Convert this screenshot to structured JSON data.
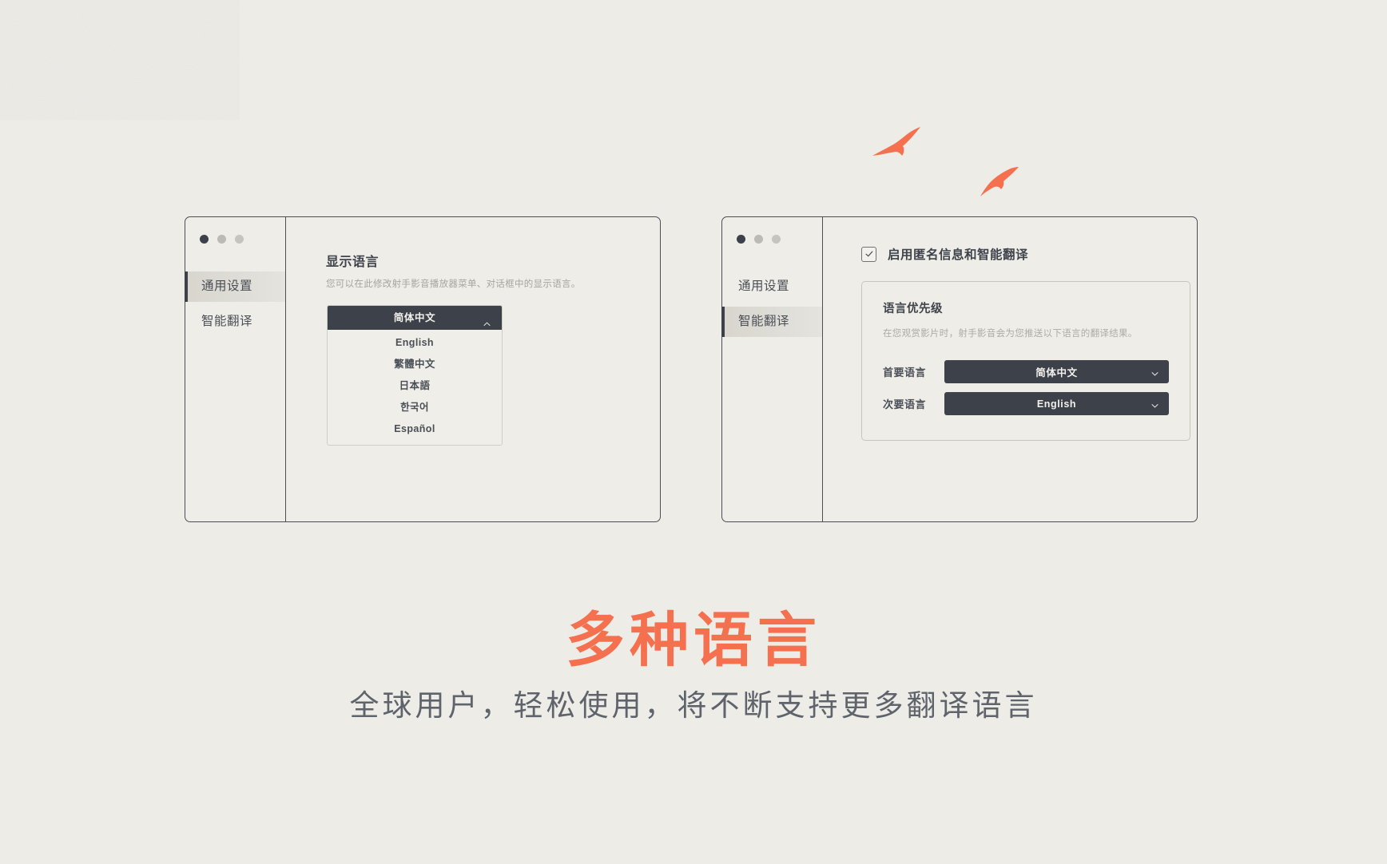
{
  "theme": {
    "background": "#edece7",
    "accent": "#f4704f",
    "ink": "#3f444c",
    "muted": "#a6a49e",
    "select_bg": "#3c414a"
  },
  "windows": {
    "left": {
      "traffic_lights": [
        "close",
        "minimize",
        "maximize"
      ],
      "sidebar": {
        "items": [
          {
            "label": "通用设置",
            "active": true
          },
          {
            "label": "智能翻译",
            "active": false
          }
        ]
      },
      "content": {
        "title": "显示语言",
        "description": "您可以在此修改射手影音播放器菜单、对话框中的显示语言。",
        "language_dropdown": {
          "selected": "简体中文",
          "expanded": true,
          "caret_icon": "chevron-up-icon",
          "options": [
            "English",
            "繁體中文",
            "日本語",
            "한국어",
            "Español"
          ]
        }
      }
    },
    "right": {
      "traffic_lights": [
        "close",
        "minimize",
        "maximize"
      ],
      "sidebar": {
        "items": [
          {
            "label": "通用设置",
            "active": false
          },
          {
            "label": "智能翻译",
            "active": true
          }
        ]
      },
      "content": {
        "checkbox": {
          "label": "启用匿名信息和智能翻译",
          "checked": true,
          "icon": "check-icon"
        },
        "panel": {
          "title": "语言优先级",
          "description": "在您观赏影片时，射手影音会为您推送以下语言的翻译结果。",
          "rows": [
            {
              "label": "首要语言",
              "value": "简体中文",
              "caret_icon": "chevron-down-icon"
            },
            {
              "label": "次要语言",
              "value": "English",
              "caret_icon": "chevron-down-icon"
            }
          ]
        }
      }
    }
  },
  "decor": {
    "birds": [
      {
        "name": "bird-silhouette-large"
      },
      {
        "name": "bird-silhouette-small"
      }
    ]
  },
  "footer": {
    "headline": "多种语言",
    "subline": "全球用户，轻松使用，将不断支持更多翻译语言"
  }
}
